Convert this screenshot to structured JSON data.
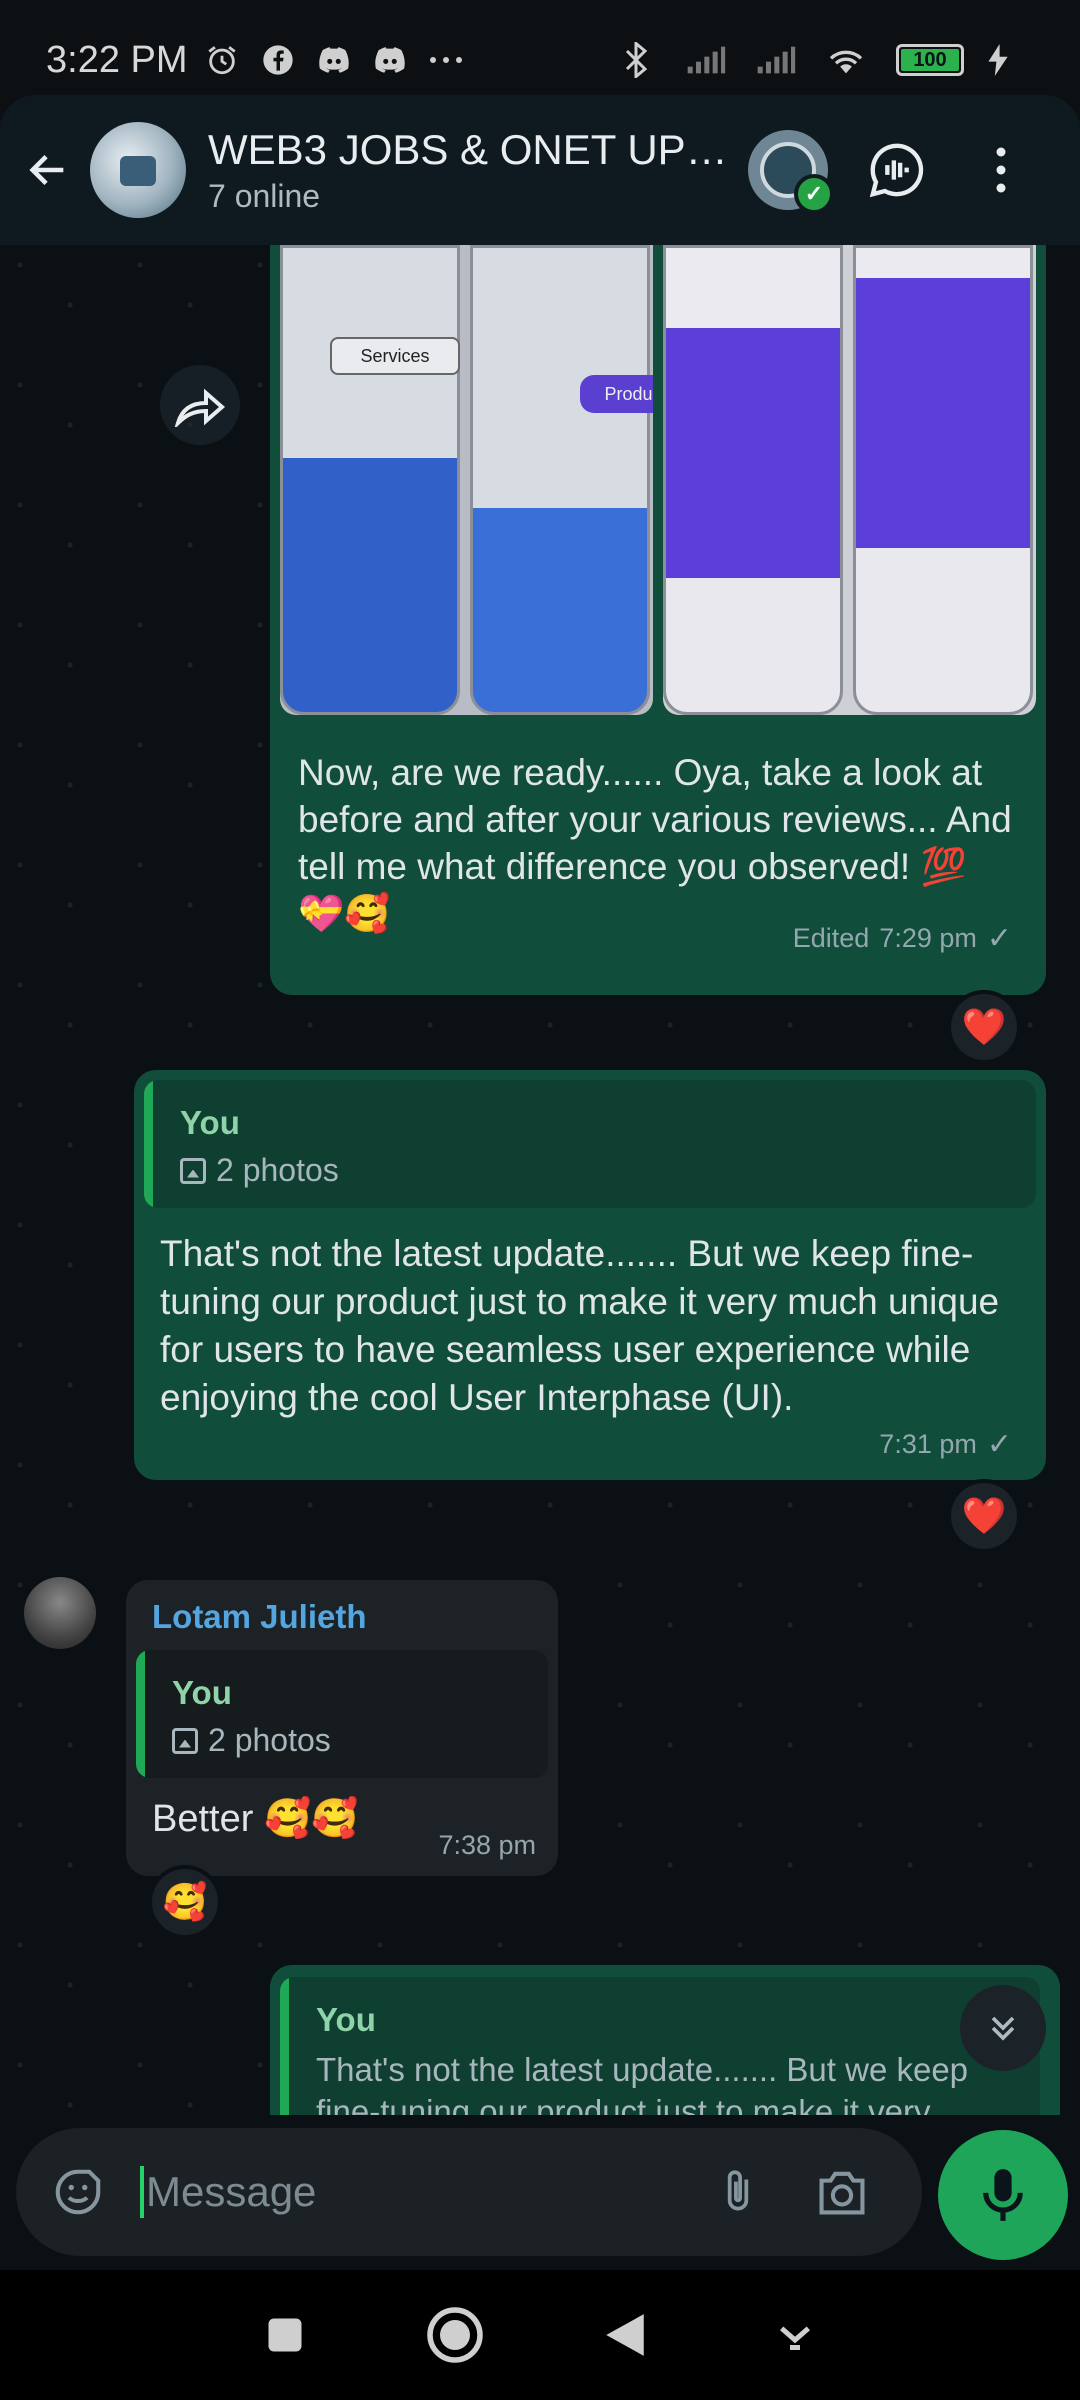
{
  "status": {
    "time": "3:22 PM",
    "battery": "100",
    "icons": [
      "alarm-icon",
      "facebook-icon",
      "discord-icon",
      "discord-icon",
      "more-dots-icon",
      "bluetooth-icon",
      "signal-icon",
      "signal-icon",
      "wifi-icon",
      "battery-icon",
      "charging-icon"
    ]
  },
  "header": {
    "title": "WEB3 JOBS & ONET UP-...",
    "subtitle": "7 online"
  },
  "photos": {
    "services_label": "Services",
    "products_label": "Products"
  },
  "messages": [
    {
      "text": "Now, are we ready...... Oya, take a look at before and after your various reviews... And tell me what difference you observed! 💯 💝🥰",
      "edited": "Edited",
      "time": "7:29 pm",
      "reaction": "❤️"
    },
    {
      "quote_name": "You",
      "quote_sub": "2 photos",
      "text": "That's not the latest update....... But we keep fine-tuning our product just to make it very much unique for users to have seamless user experience while enjoying the cool User Interphase (UI).",
      "time": "7:31 pm",
      "reaction": "❤️"
    },
    {
      "sender": "Lotam Julieth",
      "quote_name": "You",
      "quote_sub": "2 photos",
      "text": "Better 🥰🥰",
      "time": "7:38 pm",
      "reaction": "🥰"
    },
    {
      "quote_name": "You",
      "quote_snippet": "That's not the latest update....... But we keep fine-tuning our product just to make it very"
    }
  ],
  "composer": {
    "placeholder": "Message"
  },
  "colors": {
    "outgoing_bubble": "#104d3a",
    "incoming_bubble": "#1d2226",
    "accent_green": "#1ea55a",
    "sender_blue": "#53a6e0"
  }
}
